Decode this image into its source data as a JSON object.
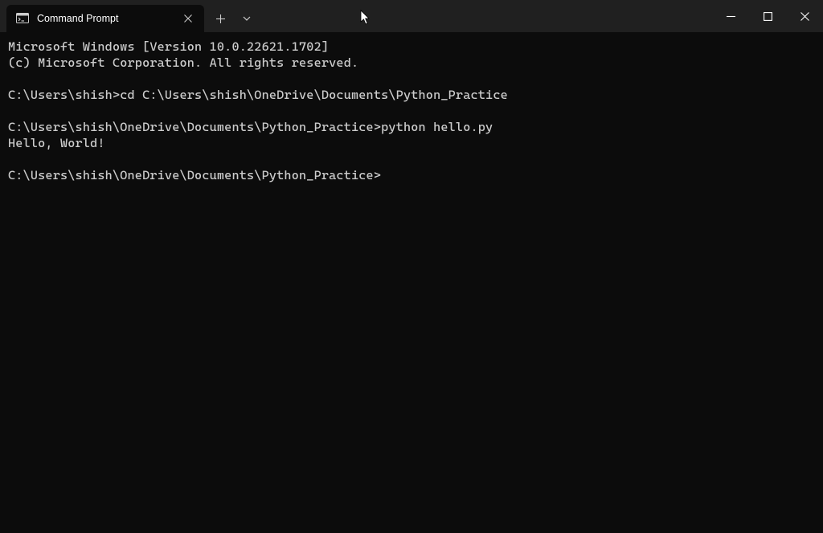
{
  "tab": {
    "title": "Command Prompt"
  },
  "terminal": {
    "line1": "Microsoft Windows [Version 10.0.22621.1702]",
    "line2": "(c) Microsoft Corporation. All rights reserved.",
    "blank1": "",
    "prompt1": "C:\\Users\\shish>",
    "cmd1": "cd C:\\Users\\shish\\OneDrive\\Documents\\Python_Practice",
    "blank2": "",
    "prompt2": "C:\\Users\\shish\\OneDrive\\Documents\\Python_Practice>",
    "cmd2": "python hello.py",
    "output1": "Hello, World!",
    "blank3": "",
    "prompt3": "C:\\Users\\shish\\OneDrive\\Documents\\Python_Practice>"
  }
}
